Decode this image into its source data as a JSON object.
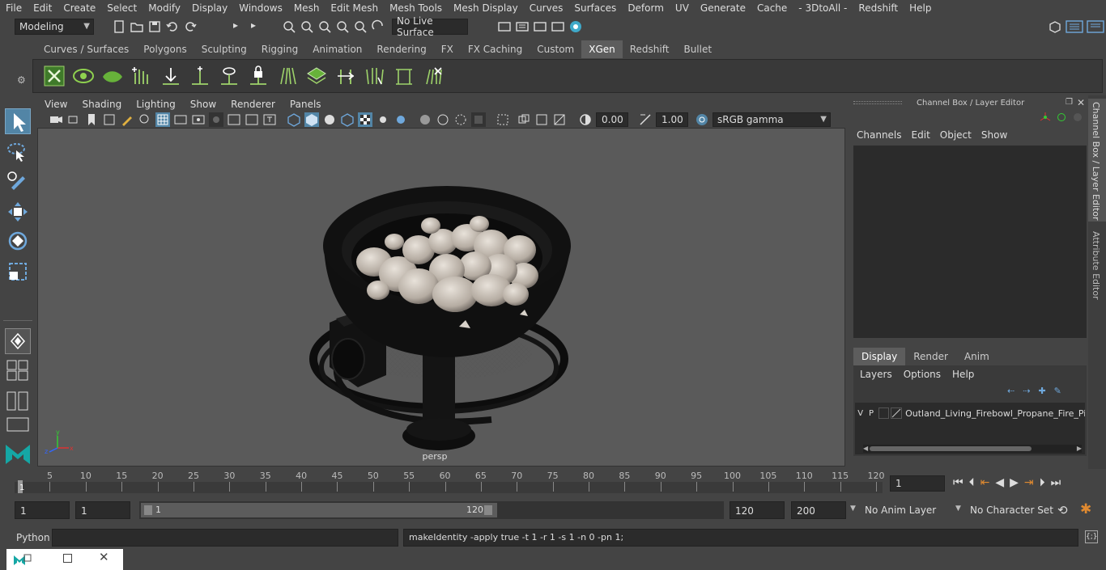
{
  "menubar": {
    "items": [
      "File",
      "Edit",
      "Create",
      "Select",
      "Modify",
      "Display",
      "Windows",
      "Mesh",
      "Edit Mesh",
      "Mesh Tools",
      "Mesh Display",
      "Curves",
      "Surfaces",
      "Deform",
      "UV",
      "Generate",
      "Cache",
      "- 3DtoAll -",
      "Redshift",
      "Help"
    ]
  },
  "status": {
    "mode": "Modeling",
    "live_surface": "No Live Surface"
  },
  "shelf": {
    "tabs": [
      "Curves / Surfaces",
      "Polygons",
      "Sculpting",
      "Rigging",
      "Animation",
      "Rendering",
      "FX",
      "FX Caching",
      "Custom",
      "XGen",
      "Redshift",
      "Bullet"
    ],
    "active_tab": "XGen"
  },
  "viewport": {
    "menu": [
      "View",
      "Shading",
      "Lighting",
      "Show",
      "Renderer",
      "Panels"
    ],
    "exposure": "0.00",
    "gamma": "1.00",
    "color_space": "sRGB gamma",
    "camera_label": "persp"
  },
  "channel_box": {
    "title": "Channel Box / Layer Editor",
    "menu": [
      "Channels",
      "Edit",
      "Object",
      "Show"
    ],
    "layer_tabs": [
      "Display",
      "Render",
      "Anim"
    ],
    "active_layer_tab": "Display",
    "layer_menu": [
      "Layers",
      "Options",
      "Help"
    ],
    "layer_row": {
      "v": "V",
      "p": "P",
      "name": "Outland_Living_Firebowl_Propane_Fire_Pit_"
    }
  },
  "side_tabs": {
    "channel_box": "Channel Box / Layer Editor",
    "attribute_editor": "Attribute Editor"
  },
  "timeline": {
    "ticks": [
      5,
      10,
      15,
      20,
      25,
      30,
      35,
      40,
      45,
      50,
      55,
      60,
      65,
      70,
      75,
      80,
      85,
      90,
      95,
      100,
      105,
      110,
      115,
      120
    ],
    "start_marker": "1",
    "current_frame": "1"
  },
  "range": {
    "start": "1",
    "playback_start": "1",
    "slider_start": "1",
    "slider_end": "120",
    "playback_end": "120",
    "end": "200",
    "anim_layer": "No Anim Layer",
    "character_set": "No Character Set"
  },
  "command": {
    "language": "Python",
    "output": "makeIdentity -apply true -t 1 -r 1 -s 1 -n 0 -pn 1;"
  },
  "colors": {
    "accent_blue": "#5285a6",
    "bg": "#444444",
    "viewport": "#5a5a5a"
  }
}
